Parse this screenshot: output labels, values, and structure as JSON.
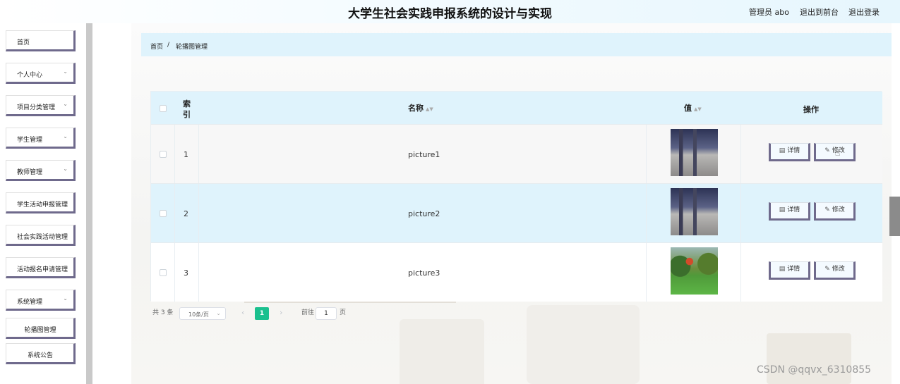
{
  "header": {
    "title": "大学生社会实践申报系统的设计与实现",
    "user_label": "管理员 abo",
    "front_link": "退出到前台",
    "logout_link": "退出登录"
  },
  "sidebar": {
    "items": [
      {
        "label": "首页",
        "has_children": false
      },
      {
        "label": "个人中心",
        "has_children": true
      },
      {
        "label": "项目分类管理",
        "has_children": true
      },
      {
        "label": "学生管理",
        "has_children": true
      },
      {
        "label": "教师管理",
        "has_children": true
      },
      {
        "label": "学生活动申报管理",
        "has_children": false
      },
      {
        "label": "社会实践活动管理",
        "has_children": false
      },
      {
        "label": "活动报名申请管理",
        "has_children": false
      },
      {
        "label": "系统管理",
        "has_children": true
      }
    ],
    "sub_items": [
      {
        "label": "轮播图管理"
      },
      {
        "label": "系统公告"
      }
    ],
    "chevron_icon": "chevron-down-icon"
  },
  "breadcrumb": {
    "home": "首页",
    "separator": "/",
    "current": "轮播图管理"
  },
  "table": {
    "columns": {
      "index_line1": "索",
      "index_line2": "引",
      "name": "名称",
      "value": "值",
      "actions": "操作"
    },
    "sort_icon": "▲▼",
    "rows": [
      {
        "index": "1",
        "name": "picture1",
        "thumbnail": "building-photo"
      },
      {
        "index": "2",
        "name": "picture2",
        "thumbnail": "building-photo"
      },
      {
        "index": "3",
        "name": "picture3",
        "thumbnail": "garden-photo"
      }
    ],
    "detail_label": "详情",
    "edit_label": "修改",
    "detail_icon": "document-icon",
    "edit_icon": "pencil-icon",
    "highlight_color": "#dff3fc"
  },
  "pagination": {
    "total_text": "共 3 条",
    "page_size": "10条/页",
    "current_page": "1",
    "goto_label": "前往",
    "goto_value": "1",
    "page_suffix": "页"
  },
  "watermark": "CSDN @qqvx_6310855",
  "colors": {
    "accent": "#1bc08e",
    "header_bg": "#dff3fc",
    "button_border": "#6f6a8c"
  }
}
